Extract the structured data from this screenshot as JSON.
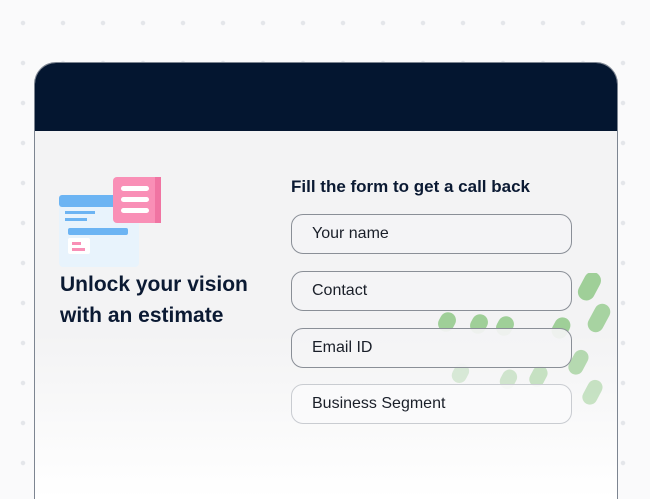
{
  "hero": {
    "headline_line1": "Unlock your vision",
    "headline_line2": "with an estimate",
    "illustration_icon": "web-estimate-illustration-icon"
  },
  "form": {
    "title": "Fill the form to get a call back",
    "fields": [
      {
        "placeholder": "Your name",
        "value": ""
      },
      {
        "placeholder": "Contact",
        "value": ""
      },
      {
        "placeholder": "Email ID",
        "value": ""
      },
      {
        "placeholder": "Business Segment",
        "value": ""
      }
    ]
  },
  "colors": {
    "header": "#041630",
    "heading_text": "#0b1a33",
    "accent_pink": "#f98fb6",
    "accent_blue": "#6cb4f3",
    "decor_green": "#9fcf98"
  }
}
